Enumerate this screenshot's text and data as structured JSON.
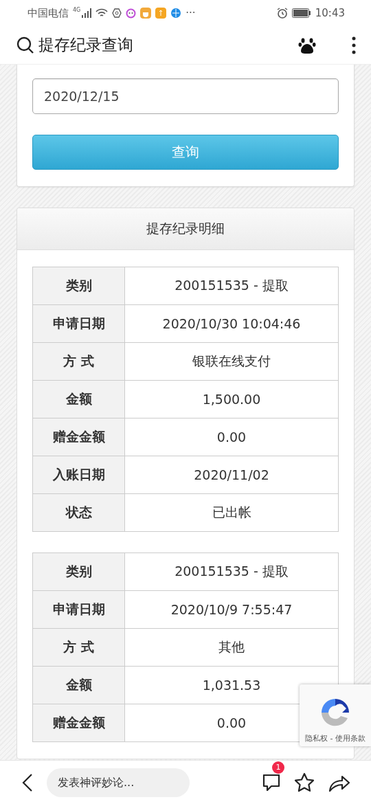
{
  "status_bar": {
    "carrier": "中国电信",
    "network": "4G",
    "more": "···",
    "time": "10:43"
  },
  "header": {
    "title": "提存纪录查询"
  },
  "query": {
    "date_value": "2020/12/15",
    "button": "查询"
  },
  "details": {
    "title": "提存纪录明细",
    "records": [
      {
        "rows": [
          {
            "label": "类别",
            "value": "200151535 - 提取"
          },
          {
            "label": "申请日期",
            "value": "2020/10/30 10:04:46"
          },
          {
            "label": "方 式",
            "value": "银联在线支付"
          },
          {
            "label": "金额",
            "value": "1,500.00"
          },
          {
            "label": "赠金金额",
            "value": "0.00"
          },
          {
            "label": "入账日期",
            "value": "2020/11/02"
          },
          {
            "label": "状态",
            "value": "已出帐"
          }
        ]
      },
      {
        "rows": [
          {
            "label": "类别",
            "value": "200151535 - 提取"
          },
          {
            "label": "申请日期",
            "value": "2020/10/9 7:55:47"
          },
          {
            "label": "方 式",
            "value": "其他"
          },
          {
            "label": "金额",
            "value": "1,031.53"
          },
          {
            "label": "赠金金额",
            "value": "0.00"
          }
        ]
      }
    ]
  },
  "recaptcha": {
    "links": "隐私权 - 使用条款"
  },
  "bottom_bar": {
    "placeholder": "发表神评妙论...",
    "comment_badge": "1"
  }
}
